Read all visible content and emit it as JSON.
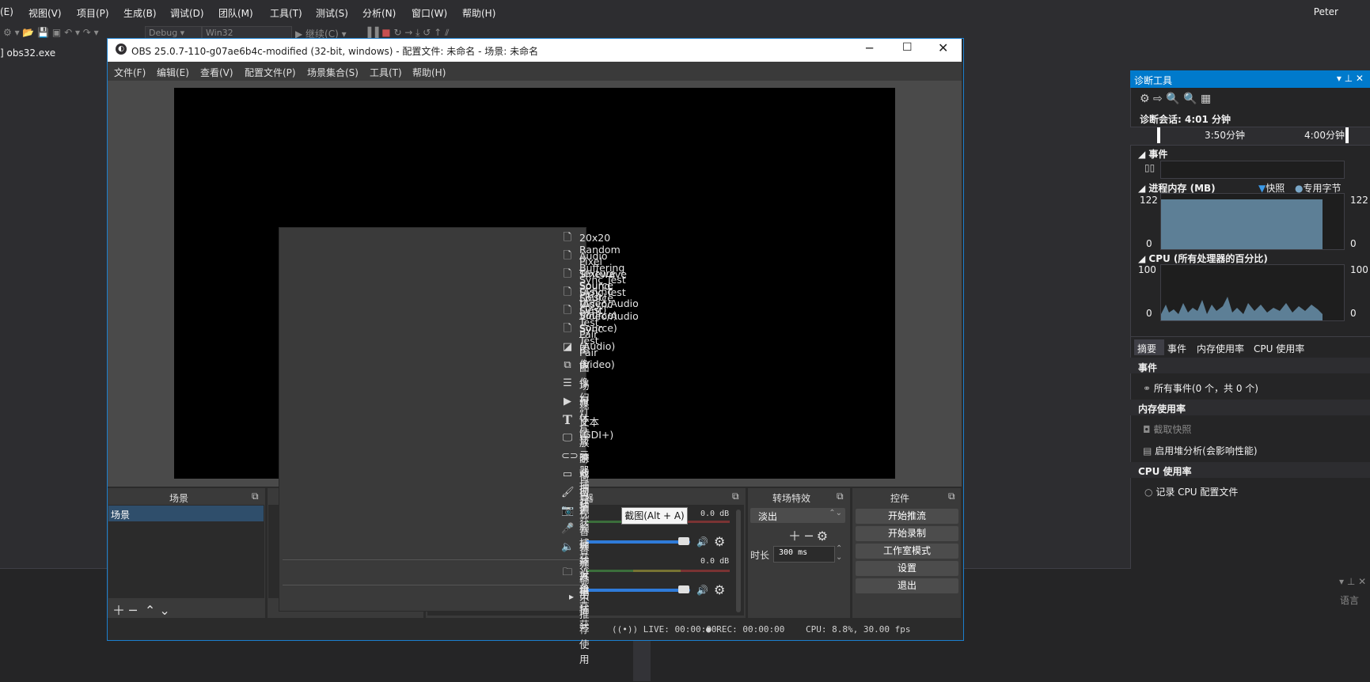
{
  "vs": {
    "menu": [
      "(E)",
      "视图(V)",
      "项目(P)",
      "生成(B)",
      "调试(D)",
      "团队(M)",
      "工具(T)",
      "测试(S)",
      "分析(N)",
      "窗口(W)",
      "帮助(H)"
    ],
    "user": "Peter",
    "config": "Debug",
    "platform": "Win32",
    "continue": "继续(C)",
    "left_tab": "] obs32.exe",
    "right_lang": "语言"
  },
  "diag": {
    "title": "诊断工具",
    "session": "诊断会话: 4:01 分钟",
    "t1": "3:50分钟",
    "t2": "4:00分钟",
    "events_header": "事件",
    "memory_header": "进程内存 (MB)",
    "snapshot_legend": "快照",
    "private_legend": "专用字节",
    "mem_max": "122",
    "mem_min": "0",
    "cpu_header": "CPU (所有处理器的百分比)",
    "cpu_max": "100",
    "cpu_min": "0",
    "tabs": [
      "摘要",
      "事件",
      "内存使用率",
      "CPU 使用率"
    ],
    "sec_events": "事件",
    "all_events": "所有事件(0 个，共 0 个)",
    "sec_memory": "内存使用率",
    "take_snapshot": "截取快照",
    "heap_profile": "启用堆分析(会影响性能)",
    "sec_cpu": "CPU 使用率",
    "record_cpu": "记录 CPU 配置文件"
  },
  "obs": {
    "title": "OBS 25.0.7-110-g07ae6b4c-modified (32-bit, windows) - 配置文件: 未命名 - 场景: 未命名",
    "menu": [
      "文件(F)",
      "编辑(E)",
      "查看(V)",
      "配置文件(P)",
      "场景集合(S)",
      "工具(T)",
      "帮助(H)"
    ],
    "scenes_title": "场景",
    "scene_item": "场景",
    "mixer_title": "器",
    "mixer_db1": "0.0 dB",
    "mixer_db2": "0.0 dB",
    "transitions_title": "转场特效",
    "transition_value": "淡出",
    "duration_label": "时长",
    "duration_value": "300 ms",
    "controls_title": "控件",
    "buttons": [
      "开始推流",
      "开始录制",
      "工作室模式",
      "设置",
      "退出"
    ],
    "status": {
      "live": "LIVE: 00:00:00",
      "rec": "REC: 00:00:00",
      "cpu": "CPU: 8.8%, 30.00 fps"
    }
  },
  "tooltip": "截图(Alt + A)",
  "context_menu": {
    "items": [
      {
        "label": "20x20 Random Pixel Texture Source (Test)",
        "icon": "file-icon"
      },
      {
        "label": "Audio Buffering Sync Test (Async Video/Audio Source)",
        "icon": "file-icon"
      },
      {
        "label": "Sinewave Sound Source (Test)",
        "icon": "file-icon"
      },
      {
        "label": "Sync Test (Async Video/Audio Source)",
        "icon": "file-icon"
      },
      {
        "label": "Sync Test Pair (Audio)",
        "icon": "file-icon"
      },
      {
        "label": "Sync Test Pair (Video)",
        "icon": "file-icon"
      },
      {
        "label": "图像",
        "icon": "image-icon"
      },
      {
        "label": "图像幻灯片放映",
        "icon": "slideshow-icon"
      },
      {
        "label": "场景",
        "icon": "list-icon"
      },
      {
        "label": "媒体源",
        "icon": "play-icon"
      },
      {
        "label": "文本 (GDI+)",
        "icon": "text-icon"
      },
      {
        "label": "显示器捕获",
        "icon": "monitor-icon"
      },
      {
        "label": "游戏捕获",
        "icon": "gamepad-icon"
      },
      {
        "label": "窗口捕获",
        "icon": "window-icon"
      },
      {
        "label": "色源",
        "icon": "brush-icon"
      },
      {
        "label": "视频捕获设备",
        "icon": "camera-icon"
      },
      {
        "label": "音频输入捕获",
        "icon": "microphone-icon"
      },
      {
        "label": "音频输出捕获",
        "icon": "speaker-icon"
      }
    ],
    "group": "分组",
    "deprecated": "不推荐使用"
  }
}
